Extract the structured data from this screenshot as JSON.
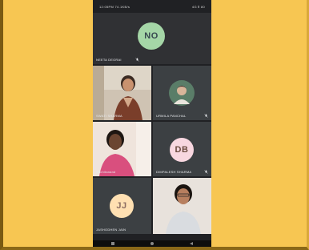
{
  "status": {
    "time": "12:05PM 74.1KB/s",
    "signal": "4G Ⅱ 80"
  },
  "tiles": [
    {
      "name": "NEETA DEORAI",
      "initials": "NO",
      "avatar_color": "#a5d6a7",
      "initials_color": "#37474f"
    },
    {
      "name": "SWATI SHARMA"
    },
    {
      "name": "URMILA PANCHAL"
    },
    {
      "name": "Sachitanand"
    },
    {
      "name": "DIMPALESH SHARMA",
      "initials": "DB",
      "avatar_color": "#f8d7e0",
      "initials_color": "#6d4c41"
    },
    {
      "name": "JASHODHEN JAIN",
      "initials": "JJ",
      "avatar_color": "#ffe0b2",
      "initials_color": "#8d6e63"
    },
    {
      "name": ""
    }
  ],
  "icons": {
    "mic": "mic-off-icon"
  }
}
